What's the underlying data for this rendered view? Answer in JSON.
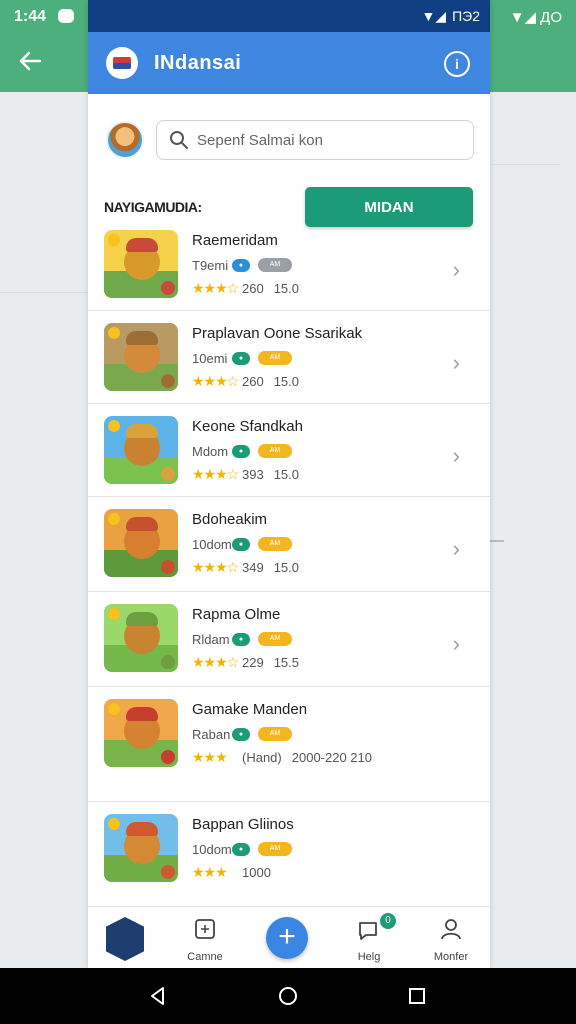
{
  "background": {
    "time": "1:44",
    "status_right": "▼◢ ДО"
  },
  "status": {
    "signal": "▼◢ ",
    "battery": "ПЭ2"
  },
  "appbar": {
    "title": "INdansai",
    "info_icon": "info-icon"
  },
  "search": {
    "placeholder": "Sepenf Salmai kon"
  },
  "section": {
    "label": "NAYIGAMUDIA:",
    "button": "MIDAN"
  },
  "games": [
    {
      "title": "Raemeridam",
      "sub": "T9emi",
      "pill1": "●",
      "pill2": "AM",
      "rating": "★★★☆",
      "n1": "260",
      "n2": "15.0",
      "colors": [
        "#f5d249",
        "#c84b3a",
        "#6fa94a",
        "#d89a2b"
      ]
    },
    {
      "title": "Praplavan Oone Ssarikak",
      "sub": "10emi",
      "pill1": "●",
      "pill2": "AM",
      "rating": "★★★☆",
      "n1": "260",
      "n2": "15.0",
      "colors": [
        "#b89a62",
        "#9d6d33",
        "#7aa84c",
        "#d38a3a"
      ]
    },
    {
      "title": "Keone Sfandkah",
      "sub": "Mdom",
      "pill1": "●",
      "pill2": "AM",
      "rating": "★★★☆",
      "n1": "393",
      "n2": "15.0",
      "colors": [
        "#5bb3e8",
        "#d9a23c",
        "#7cc24f",
        "#c9822f"
      ]
    },
    {
      "title": "Bdoheakim",
      "sub": "10dom",
      "pill1": "●",
      "pill2": "AM",
      "rating": "★★★☆",
      "n1": "349",
      "n2": "15.0",
      "colors": [
        "#e9a241",
        "#c6512e",
        "#5d9b3a",
        "#d77f2f"
      ]
    },
    {
      "title": "Rapma Olme",
      "sub": "Rldam",
      "pill1": "●",
      "pill2": "AM",
      "rating": "★★★☆",
      "n1": "229",
      "n2": "15.5",
      "colors": [
        "#9bd86a",
        "#6d9e3f",
        "#75b94a",
        "#c9842f"
      ]
    },
    {
      "title": "Gamake Manden",
      "sub": "Raban",
      "pill1": "●",
      "pill2": "AM",
      "rating": "★★★",
      "n1": "(Hand)",
      "n2": "2000-220 210",
      "colors": [
        "#f1a84a",
        "#c83e2e",
        "#79b54b",
        "#d48431"
      ]
    },
    {
      "title": "Bappan Gliinos",
      "sub": "10dom",
      "pill1": "●",
      "pill2": "AM",
      "rating": "★★★",
      "n1": "1000",
      "n2": "",
      "colors": [
        "#73bde9",
        "#cf5a30",
        "#71ad45",
        "#d48a34"
      ]
    }
  ],
  "nav": {
    "item1": "",
    "item2": "Camne",
    "item3": "+",
    "item4": "Helg",
    "item4_badge": "0",
    "item5": "Monfer"
  }
}
